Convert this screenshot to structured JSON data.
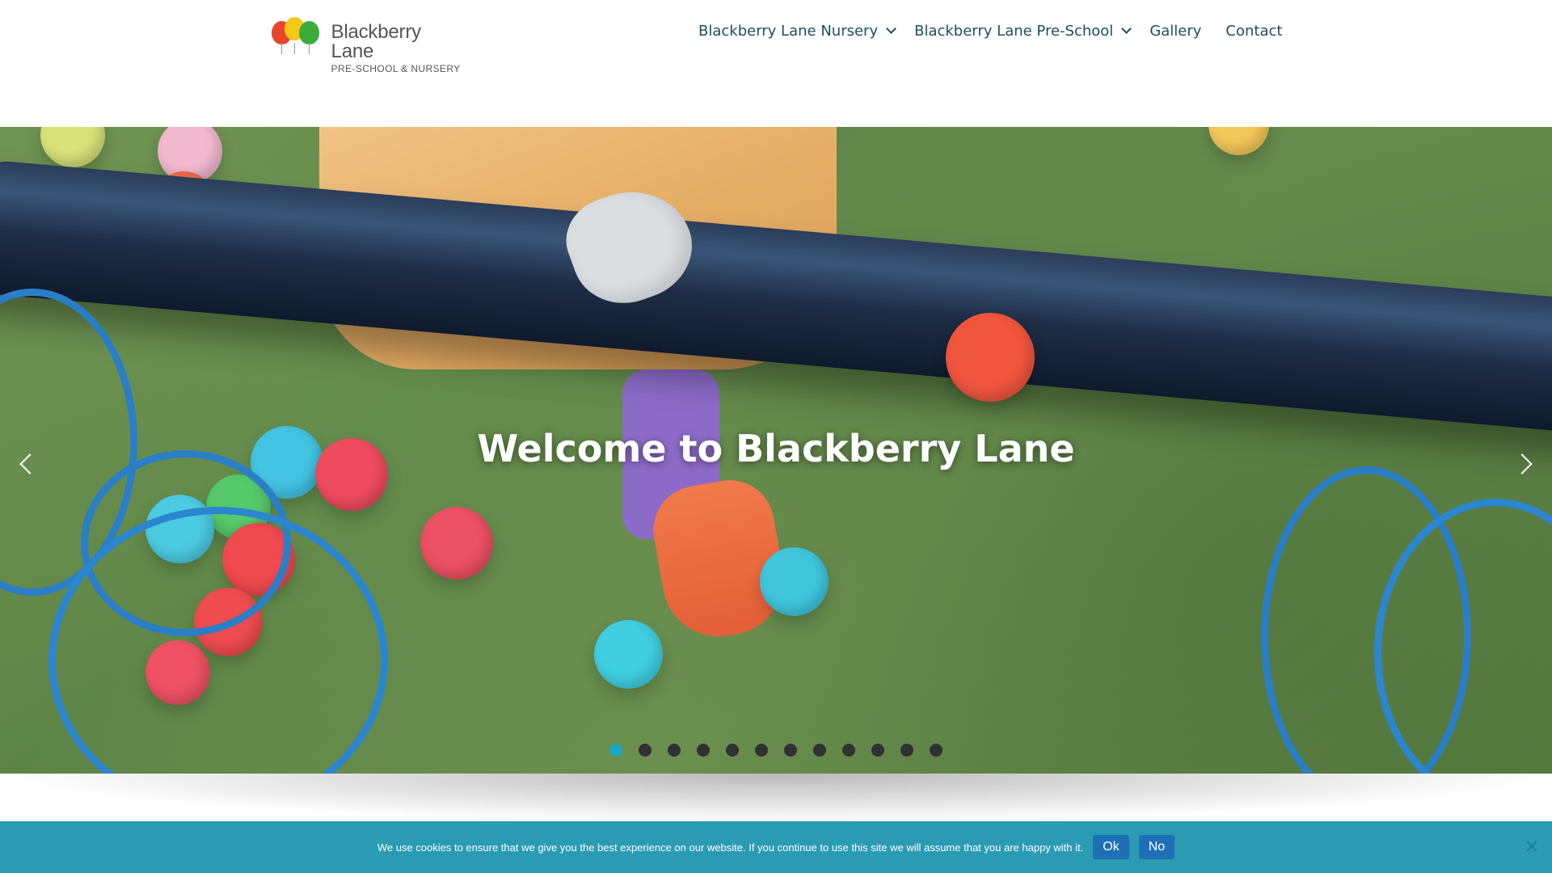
{
  "brand": {
    "name": "Blackberry Lane",
    "tagline": "PRE-SCHOOL & NURSERY"
  },
  "nav": {
    "items": [
      {
        "label": "Blackberry Lane Nursery",
        "has_submenu": true
      },
      {
        "label": "Blackberry Lane Pre-School",
        "has_submenu": true
      },
      {
        "label": "Gallery",
        "has_submenu": false
      },
      {
        "label": "Contact",
        "has_submenu": false
      }
    ]
  },
  "hero": {
    "title": "Welcome to Blackberry Lane",
    "slide_count": 12,
    "active_slide": 1,
    "prev_icon": "chevron-left-icon",
    "next_icon": "chevron-right-icon"
  },
  "cookie": {
    "message": "We use cookies to ensure that we give you the best experience on our website. If you continue to use this site we will assume that you are happy with it.",
    "ok_label": "Ok",
    "no_label": "No",
    "close_icon": "close-icon"
  },
  "colors": {
    "accent": "#1ba7bf",
    "nav_text": "#1d4e5f",
    "cookie_bar": "#2a9bb3",
    "cookie_button": "#1f6fb7"
  }
}
